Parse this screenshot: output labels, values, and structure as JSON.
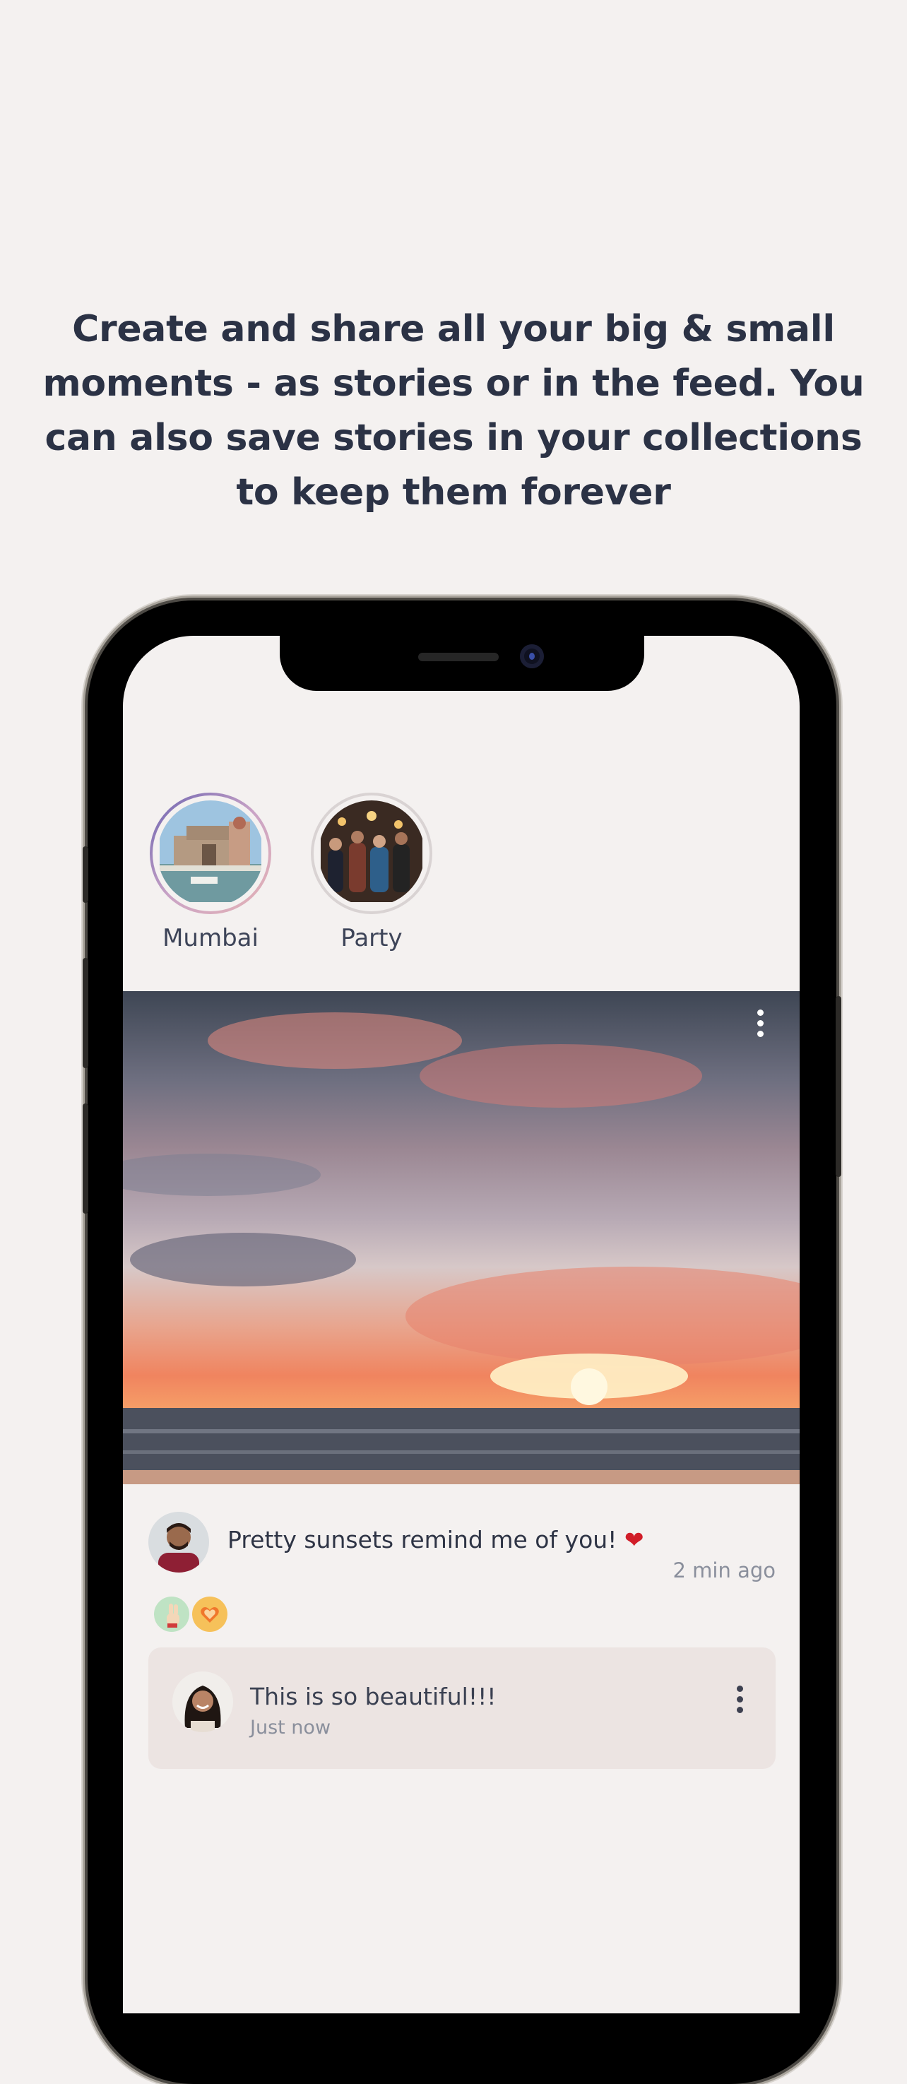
{
  "headline": "Create and share all your big & small moments - as stories or in the feed. You can also save stories in your collections to keep them forever",
  "stories": [
    {
      "label": "Mumbai",
      "state": "unseen"
    },
    {
      "label": "Party",
      "state": "seen"
    }
  ],
  "post": {
    "caption": "Pretty sunsets remind me of you!",
    "caption_emoji": "❤",
    "time": "2 min ago",
    "reactions": [
      "peace-sign-icon",
      "heart-badge-icon"
    ]
  },
  "comment": {
    "text": "This is so beautiful!!!",
    "time": "Just now"
  },
  "colors": {
    "background": "#f4f1f0",
    "headline": "#2b3245",
    "comment_bg": "#ece4e2"
  }
}
